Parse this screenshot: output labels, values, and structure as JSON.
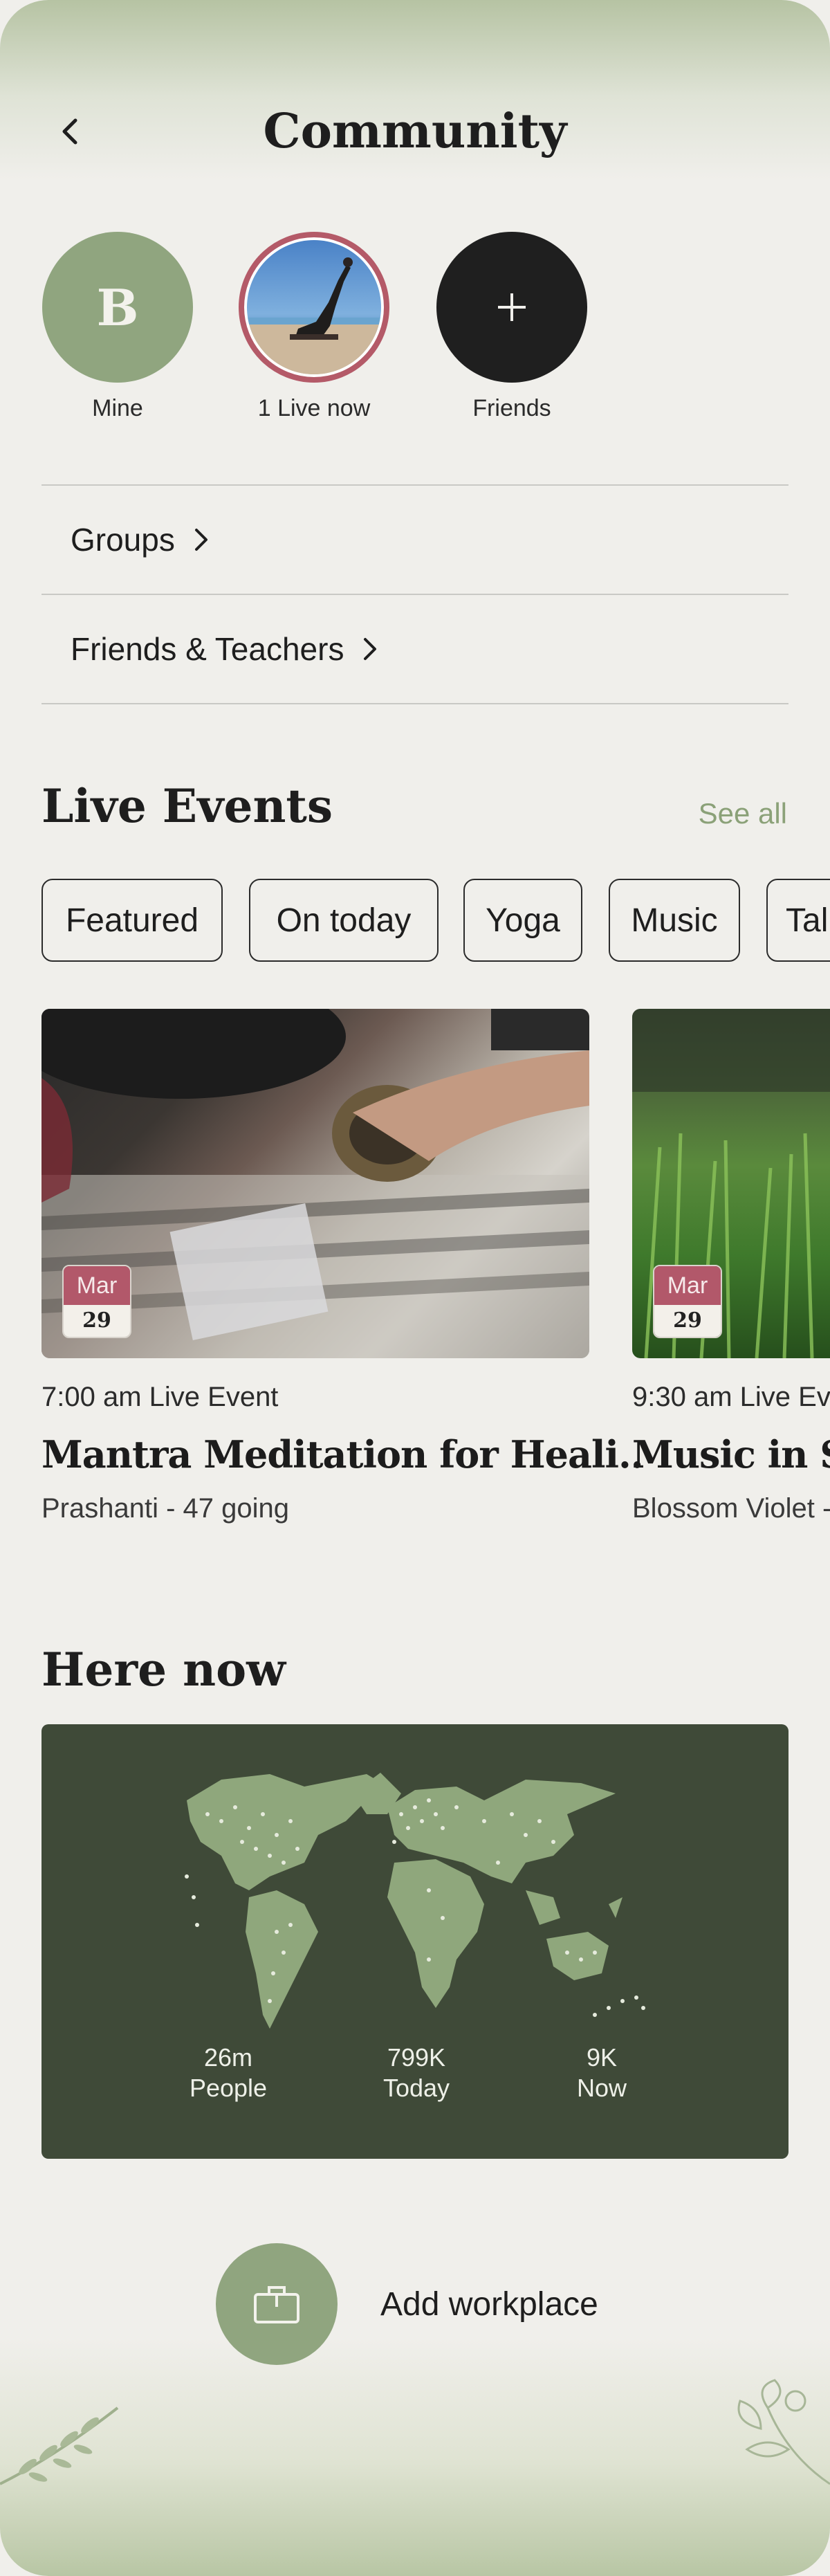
{
  "header": {
    "title": "Community"
  },
  "stories": {
    "mine": {
      "initial": "B",
      "label": "Mine"
    },
    "live": {
      "label": "1 Live now"
    },
    "friends": {
      "label": "Friends"
    }
  },
  "nav": {
    "groups": "Groups",
    "friends_teachers": "Friends & Teachers"
  },
  "live_events": {
    "title": "Live Events",
    "see_all": "See all",
    "chips": [
      "Featured",
      "On today",
      "Yoga",
      "Music",
      "Tal"
    ],
    "events": [
      {
        "month": "Mar",
        "day": "29",
        "time": "7:00 am Live Event",
        "title": "Mantra Meditation for Heali..",
        "meta": "Prashanti - 47 going"
      },
      {
        "month": "Mar",
        "day": "29",
        "time": "9:30 am Live Ev",
        "title": "Music in Sl",
        "meta": "Blossom Violet -"
      }
    ]
  },
  "here_now": {
    "title": "Here now",
    "stats": [
      {
        "value": "26m",
        "label": "People"
      },
      {
        "value": "799K",
        "label": "Today"
      },
      {
        "value": "9K",
        "label": "Now"
      }
    ]
  },
  "workplace": {
    "label": "Add workplace"
  },
  "colors": {
    "accent_green": "#90a57f",
    "live_ring": "#b45a68",
    "map_bg": "#3f4a38",
    "background": "#f0efeb"
  }
}
